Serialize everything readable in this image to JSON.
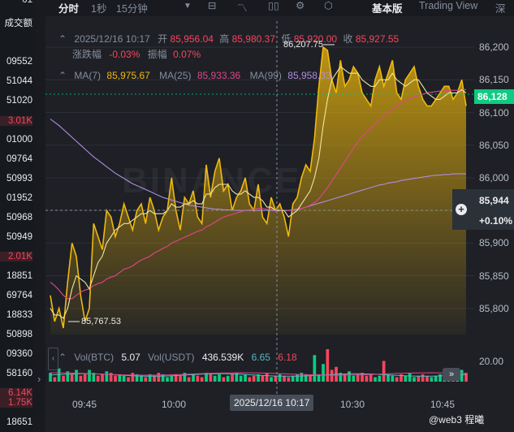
{
  "left_column": {
    "cells": [
      "01",
      "成交额",
      "09552",
      "51044",
      "51020",
      "3.01K",
      "01000",
      "09764",
      "50993",
      "01952",
      "50968",
      "50949",
      "2.01K",
      "18851",
      "69764",
      "18833",
      "50898",
      "09360",
      "58160",
      "6.14K",
      "1.75K",
      "18651"
    ]
  },
  "toolbar": {
    "time_label": "分时",
    "interval_1s": "1秒",
    "interval_15m": "15分钟",
    "basic_label": "基本版",
    "tradingview_label": "Trading View",
    "depth_label": "深度"
  },
  "ohlc": {
    "date": "2025/12/16 10:17",
    "open_label": "开",
    "open": "85,956.04",
    "high_label": "高",
    "high": "85,980.37",
    "low_label": "低",
    "low": "85,920.00",
    "close_label": "收",
    "close": "85,927.55",
    "change_label": "涨跌幅",
    "change": "-0.03%",
    "amp_label": "振幅",
    "amp": "0.07%"
  },
  "ma": {
    "ma7_label": "MA(7)",
    "ma7": "85,975.67",
    "ma25_label": "MA(25)",
    "ma25": "85,933.36",
    "ma99_label": "MA(99)",
    "ma99": "85,958.33"
  },
  "volume": {
    "vol_btc_label": "Vol(BTC)",
    "vol_btc": "5.07",
    "vol_usdt_label": "Vol(USDT)",
    "vol_usdt": "436.539K",
    "v1": "6.65",
    "v2": "6.18",
    "axis_label": "20.00"
  },
  "price_tag": {
    "current": "86,128",
    "crosshair": "85,944",
    "crosshair_pct": "+0.10%"
  },
  "markers": {
    "high": "86,207.75",
    "low": "85,767.53"
  },
  "crosshair_time": "2025/12/16 10:17",
  "watermark": "BINANCE",
  "source_badge": "@web3 程曦",
  "colors": {
    "up": "#0ecb81",
    "down": "#f6465d",
    "line": "#f0b90b",
    "ma7": "#f0b90b",
    "ma25": "#e0468a",
    "ma99": "#b18ce0"
  },
  "chart_data": {
    "type": "area",
    "y_ticks": [
      "86,200",
      "86,150",
      "86,100",
      "86,050",
      "86,000",
      "85,950",
      "85,900",
      "85,850",
      "85,800"
    ],
    "x_ticks": [
      "09:45",
      "10:00",
      "10:30",
      "10:45"
    ],
    "ylim": [
      85760,
      86215
    ],
    "price": [
      85820,
      85780,
      85800,
      85770,
      85840,
      85900,
      85880,
      85820,
      85780,
      85800,
      85930,
      85910,
      85890,
      85950,
      85940,
      85910,
      85930,
      85960,
      85940,
      85920,
      85950,
      85960,
      85930,
      85970,
      85950,
      85920,
      85940,
      85950,
      86000,
      85950,
      85920,
      85970,
      85960,
      85980,
      85940,
      85930,
      86020,
      85970,
      86010,
      86030,
      85980,
      85990,
      85950,
      85970,
      85980,
      86000,
      85960,
      85950,
      85990,
      85940,
      85930,
      85970,
      85950,
      85960,
      85940,
      85910,
      85960,
      85970,
      86000,
      86020,
      86010,
      86060,
      86140,
      86200,
      86195,
      86150,
      86130,
      86180,
      86140,
      86150,
      86170,
      86160,
      86130,
      86120,
      86110,
      86150,
      86170,
      86140,
      86160,
      86180,
      86130,
      86120,
      86150,
      86160,
      86170,
      86140,
      86120,
      86110,
      86110,
      86120,
      86130,
      86140,
      86140,
      86120,
      86130,
      86150,
      86110
    ],
    "ma7": [
      85800,
      85790,
      85790,
      85785,
      85800,
      85830,
      85850,
      85845,
      85840,
      85830,
      85850,
      85870,
      85880,
      85900,
      85910,
      85920,
      85925,
      85930,
      85930,
      85935,
      85940,
      85945,
      85945,
      85950,
      85945,
      85945,
      85945,
      85950,
      85960,
      85955,
      85955,
      85960,
      85960,
      85965,
      85960,
      85960,
      85975,
      85975,
      85985,
      85990,
      85990,
      85990,
      85980,
      85975,
      85975,
      85980,
      85975,
      85970,
      85970,
      85965,
      85955,
      85955,
      85950,
      85950,
      85950,
      85940,
      85945,
      85950,
      85960,
      85970,
      85980,
      86000,
      86030,
      86080,
      86120,
      86150,
      86160,
      86170,
      86165,
      86160,
      86160,
      86160,
      86150,
      86145,
      86140,
      86140,
      86150,
      86150,
      86150,
      86160,
      86150,
      86145,
      86140,
      86145,
      86150,
      86150,
      86140,
      86130,
      86125,
      86120,
      86120,
      86125,
      86130,
      86130,
      86130,
      86135,
      86130
    ],
    "ma25": [
      85840,
      85835,
      85828,
      85820,
      85815,
      85815,
      85820,
      85825,
      85828,
      85830,
      85835,
      85838,
      85840,
      85845,
      85848,
      85850,
      85855,
      85860,
      85862,
      85865,
      85870,
      85874,
      85877,
      85880,
      85885,
      85888,
      85892,
      85895,
      85900,
      85903,
      85906,
      85909,
      85912,
      85915,
      85918,
      85920,
      85925,
      85928,
      85932,
      85936,
      85940,
      85942,
      85944,
      85946,
      85948,
      85950,
      85951,
      85952,
      85953,
      85953,
      85952,
      85952,
      85951,
      85951,
      85950,
      85950,
      85950,
      85951,
      85953,
      85955,
      85958,
      85962,
      85968,
      85976,
      85985,
      85995,
      86005,
      86015,
      86025,
      86035,
      86045,
      86055,
      86063,
      86070,
      86076,
      86082,
      86088,
      86094,
      86100,
      86105,
      86110,
      86115,
      86118,
      86121,
      86124,
      86126,
      86128,
      86130,
      86131,
      86132,
      86133,
      86133,
      86134,
      86134,
      86134,
      86135,
      86135
    ],
    "ma99": [
      86090,
      86085,
      86080,
      86074,
      86068,
      86062,
      86056,
      86050,
      86044,
      86038,
      86032,
      86027,
      86022,
      86017,
      86012,
      86007,
      86003,
      85999,
      85995,
      85991,
      85988,
      85985,
      85982,
      85979,
      85976,
      85973,
      85970,
      85968,
      85966,
      85964,
      85962,
      85960,
      85958,
      85957,
      85956,
      85955,
      85954,
      85953,
      85952,
      85952,
      85951,
      85951,
      85951,
      85950,
      85950,
      85950,
      85950,
      85950,
      85950,
      85950,
      85950,
      85950,
      85950,
      85950,
      85950,
      85950,
      85951,
      85952,
      85953,
      85955,
      85957,
      85959,
      85961,
      85963,
      85965,
      85967,
      85969,
      85971,
      85973,
      85975,
      85977,
      85979,
      85981,
      85983,
      85985,
      85987,
      85989,
      85990,
      85992,
      85993,
      85994,
      85996,
      85997,
      85998,
      85999,
      86000,
      86001,
      86002,
      86003,
      86004,
      86004,
      86005,
      86005,
      86006,
      86006,
      86006,
      86006
    ],
    "volumes": [
      6,
      3,
      9,
      4,
      7,
      5,
      8,
      4,
      5,
      8,
      6,
      4,
      5,
      7,
      6,
      4,
      5,
      4,
      3,
      6,
      5,
      4,
      3,
      5,
      4,
      6,
      5,
      3,
      4,
      5,
      4,
      6,
      3,
      5,
      4,
      3,
      6,
      5,
      4,
      5,
      3,
      4,
      5,
      6,
      4,
      5,
      3,
      4,
      5,
      4,
      6,
      3,
      4,
      5,
      4,
      3,
      4,
      5,
      6,
      5,
      4,
      18,
      5,
      12,
      22,
      8,
      10,
      6,
      5,
      7,
      4,
      5,
      6,
      4,
      5,
      3,
      4,
      14,
      5,
      4,
      3,
      5,
      4,
      6,
      3,
      4,
      5,
      4,
      3,
      4,
      5,
      4,
      3,
      4,
      5,
      8,
      6
    ],
    "volume_up": [
      1,
      0,
      1,
      0,
      1,
      0,
      1,
      0,
      0,
      1,
      1,
      0,
      0,
      1,
      0,
      0,
      1,
      1,
      0,
      0,
      1,
      1,
      0,
      1,
      0,
      0,
      1,
      1,
      1,
      0,
      0,
      1,
      0,
      1,
      0,
      0,
      1,
      0,
      1,
      1,
      0,
      1,
      0,
      1,
      1,
      1,
      0,
      0,
      1,
      0,
      0,
      1,
      0,
      1,
      0,
      0,
      1,
      1,
      1,
      1,
      0,
      1,
      1,
      1,
      0,
      0,
      0,
      1,
      0,
      1,
      1,
      0,
      0,
      0,
      0,
      1,
      1,
      0,
      1,
      1,
      0,
      0,
      1,
      1,
      1,
      0,
      0,
      0,
      1,
      1,
      1,
      1,
      0,
      0,
      1,
      1,
      0
    ]
  }
}
